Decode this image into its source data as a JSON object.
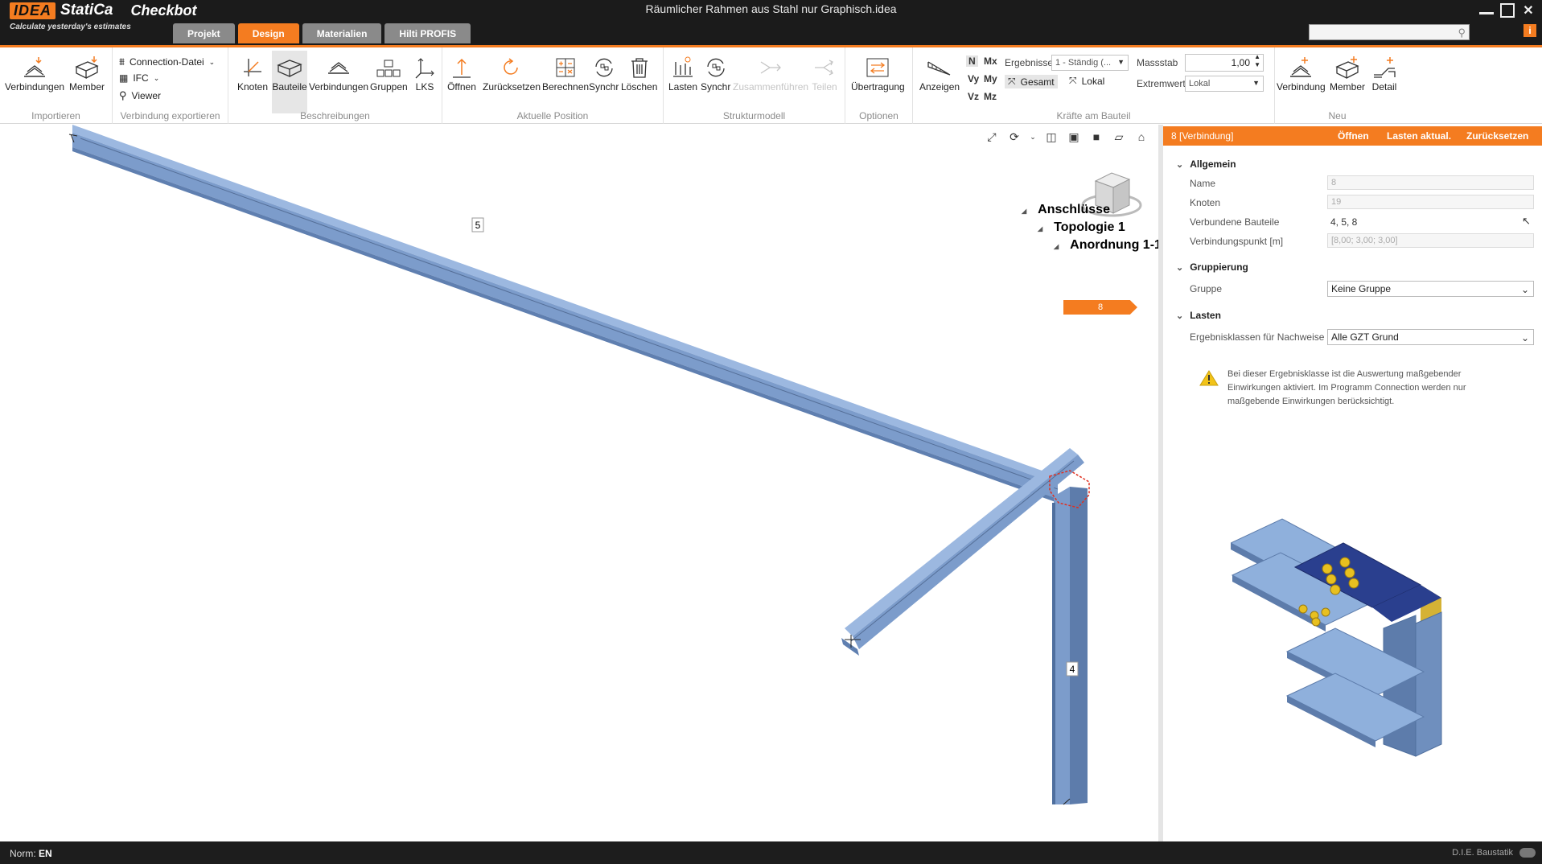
{
  "app": {
    "logo_brand": "IDEA",
    "logo_name": "StatiCa",
    "logo_product": "Checkbot",
    "tagline": "Calculate yesterday's estimates",
    "document_title": "Räumlicher Rahmen aus Stahl nur Graphisch.idea"
  },
  "tabs": [
    {
      "label": "Projekt",
      "active": false
    },
    {
      "label": "Design",
      "active": true
    },
    {
      "label": "Materialien",
      "active": false
    },
    {
      "label": "Hilti PROFIS",
      "active": false
    }
  ],
  "window_controls": {
    "minimize": "–",
    "maximize": "□",
    "close": "✕"
  },
  "search": {
    "placeholder": "",
    "value": ""
  },
  "ribbon": {
    "importieren": {
      "label": "Importieren",
      "verbindungen": "Verbindungen",
      "member": "Member"
    },
    "export": {
      "label": "Verbindung exportieren",
      "connection_datei": "Connection-Datei",
      "ifc": "IFC",
      "viewer": "Viewer"
    },
    "beschreibungen": {
      "label": "Beschreibungen",
      "knoten": "Knoten",
      "bauteile": "Bauteile",
      "verbindungen": "Verbindungen",
      "gruppen": "Gruppen",
      "lks": "LKS"
    },
    "position": {
      "label": "Aktuelle Position",
      "oeffnen": "Öffnen",
      "zuruecksetzen": "Zurücksetzen",
      "berechnen": "Berechnen",
      "synchr": "Synchr",
      "loeschen": "Löschen"
    },
    "struktur": {
      "label": "Strukturmodell",
      "lasten": "Lasten",
      "synchr": "Synchr",
      "zusammenfuehren": "Zusammenführen",
      "teilen": "Teilen"
    },
    "optionen": {
      "label": "Optionen",
      "uebertragung": "Übertragung"
    },
    "kraefte": {
      "label": "Kräfte am Bauteil",
      "anzeigen": "Anzeigen",
      "n": "N",
      "mx": "Mx",
      "vy": "Vy",
      "my": "My",
      "vz": "Vz",
      "mz": "Mz",
      "ergebnisse_label": "Ergebnisse",
      "ergebnisse_value": "1 - Ständig (...",
      "gesamt": "Gesamt",
      "lokal": "Lokal",
      "massstab_label": "Massstab",
      "massstab_value": "1,00",
      "extremwert_label": "Extremwert",
      "extremwert_value": "Lokal"
    },
    "neu": {
      "label": "Neu",
      "verbindung": "Verbindung",
      "member": "Member",
      "detail": "Detail"
    }
  },
  "viewport": {
    "member_labels": [
      "5",
      "4"
    ],
    "tree": {
      "root": "Anschlüsse",
      "topology": "Topologie 1",
      "arrangement": "Anordnung 1-1",
      "connection": "8"
    },
    "colors": {
      "steel": "#7a9ccf",
      "steel_dark": "#4f6f9e",
      "highlight": "#e03020"
    }
  },
  "panel": {
    "header_title": "8  [Verbindung]",
    "header_actions": [
      "Öffnen",
      "Lasten aktual.",
      "Zurücksetzen"
    ],
    "allgemein": {
      "title": "Allgemein",
      "name_label": "Name",
      "name_value": "8",
      "knoten_label": "Knoten",
      "knoten_value": "19",
      "bauteile_label": "Verbundene Bauteile",
      "bauteile_value": "4, 5, 8",
      "punkt_label": "Verbindungspunkt [m]",
      "punkt_value": "[8,00; 3,00; 3,00]"
    },
    "gruppierung": {
      "title": "Gruppierung",
      "gruppe_label": "Gruppe",
      "gruppe_value": "Keine Gruppe"
    },
    "lasten": {
      "title": "Lasten",
      "ergebnisklassen_label": "Ergebnisklassen für Nachweise",
      "ergebnisklassen_value": "Alle GZT Grund"
    },
    "warning_text": "Bei dieser Ergebnisklasse ist die Auswertung maßgebender Einwirkungen aktiviert. Im Programm Connection werden nur maßgebende Einwirkungen berücksichtigt."
  },
  "status": {
    "norm_label": "Norm:",
    "norm_value": "EN",
    "vendor": "D.I.E. Baustatik"
  },
  "accent_color": "#f47c20"
}
